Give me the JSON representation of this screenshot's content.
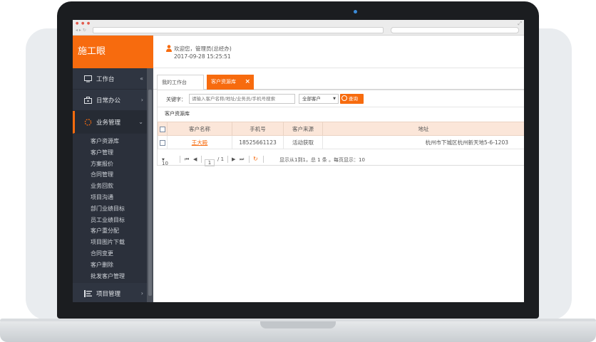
{
  "app": {
    "brand": "施工眼"
  },
  "header": {
    "welcome": "欢迎您，管理员(总经办)",
    "datetime": "2017-09-28 15:25:51"
  },
  "sidebar": {
    "collapse_icon": "«",
    "items": [
      {
        "label": "工作台",
        "icon": "monitor-icon"
      },
      {
        "label": "日常办公",
        "icon": "briefcase-icon",
        "arrow": "›"
      },
      {
        "label": "业务管理",
        "icon": "spinner-icon",
        "arrow": "⌄"
      }
    ],
    "sub_items": [
      "客户资源库",
      "客户管理",
      "方案报价",
      "合同管理",
      "业务回款",
      "项目沟通",
      "部门业绩目标",
      "员工业绩目标",
      "客户重分配",
      "项目图片下载",
      "合同变更",
      "客户删除",
      "批发客户管理"
    ],
    "bottom_item": {
      "label": "项目管理",
      "icon": "list-icon",
      "arrow": "›"
    }
  },
  "tabs": [
    {
      "label": "我的工作台"
    },
    {
      "label": "客户资源库",
      "close": "×"
    }
  ],
  "search": {
    "keyword_label": "关键字：",
    "placeholder": "请输入客户名称/地址/业务员/手机号搜索",
    "select_value": "全部客户",
    "button_label": "查询"
  },
  "section_title": "客户资源库",
  "table": {
    "headers": [
      "客户名称",
      "手机号",
      "客户来源",
      "地址"
    ],
    "rows": [
      {
        "name": "王大殿",
        "phone": "18525661123",
        "source": "活动获取",
        "address": "杭州市下城区杭州新天地5-6-1203"
      }
    ]
  },
  "pager": {
    "page_size": "10",
    "page_input": "1",
    "page_total": "/ 1",
    "summary": "显示从1到1，总 1 条 。每页显示：10"
  },
  "colors": {
    "accent": "#f76b0e",
    "sidebar": "#2f3541"
  }
}
